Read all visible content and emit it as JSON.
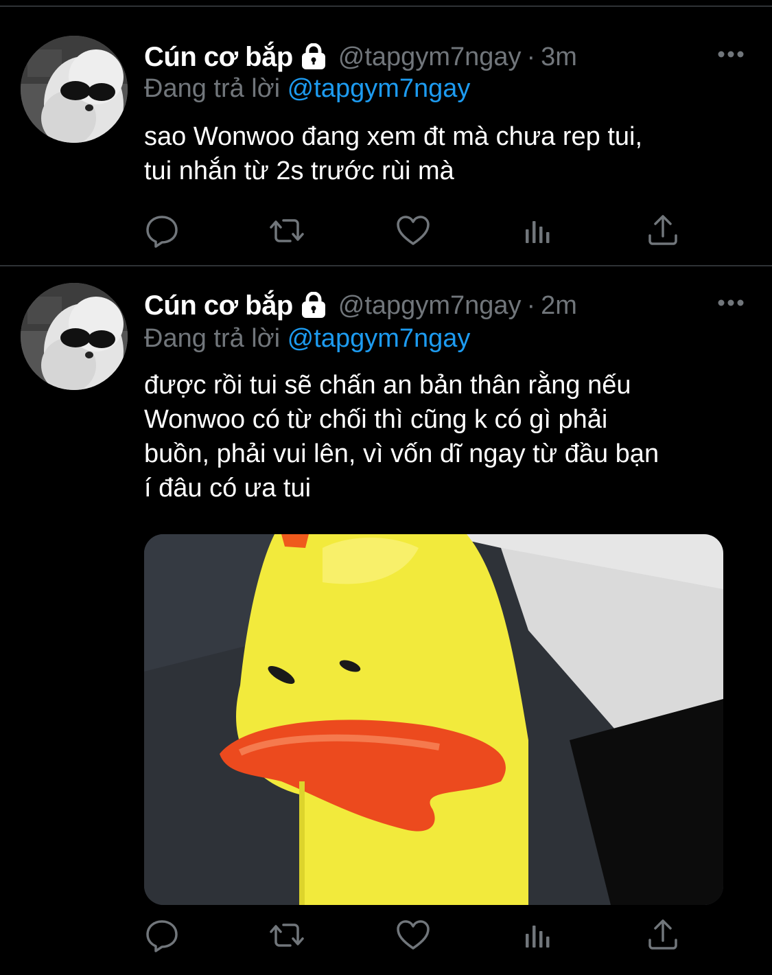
{
  "colors": {
    "background": "#000000",
    "divider": "#2f3336",
    "secondary_text": "#71767b",
    "link": "#1d9bf0",
    "primary_text": "#ffffff"
  },
  "tweets": [
    {
      "display_name": "Cún cơ bắp",
      "handle": "@tapgym7ngay",
      "separator": "·",
      "time": "3m",
      "reply_prefix": "Đang trả lời",
      "reply_to": "@tapgym7ngay",
      "text_lines": [
        "sao Wonwoo đang xem đt mà chưa rep tui,",
        "tui nhắn từ 2s trước rùi mà"
      ],
      "icons": [
        "lock-icon",
        "more-icon",
        "reply-icon",
        "retweet-icon",
        "like-icon",
        "views-icon",
        "share-icon"
      ]
    },
    {
      "display_name": "Cún cơ bắp",
      "handle": "@tapgym7ngay",
      "separator": "·",
      "time": "2m",
      "reply_prefix": "Đang trả lời",
      "reply_to": "@tapgym7ngay",
      "text_lines": [
        "được rồi tui sẽ chấn an bản thân rằng nếu",
        "Wonwoo có từ chối thì cũng k có gì phải",
        "buồn, phải vui lên, vì vốn dĩ ngay từ đầu bạn",
        "í đâu có ưa tui"
      ],
      "has_media": true,
      "icons": [
        "lock-icon",
        "more-icon",
        "reply-icon",
        "retweet-icon",
        "like-icon",
        "views-icon",
        "share-icon"
      ]
    }
  ]
}
